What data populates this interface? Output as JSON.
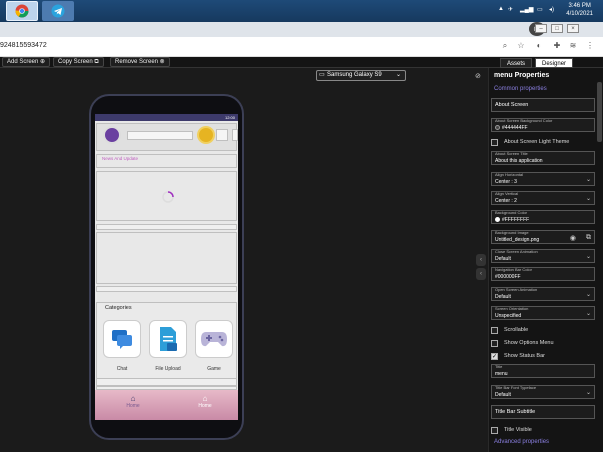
{
  "taskbar": {
    "apps": [
      {
        "name": "Chrome"
      },
      {
        "name": "Telegram"
      }
    ],
    "clock": {
      "time": "3:46 PM",
      "date": "4/10/2021"
    }
  },
  "browser": {
    "url_partial": "924815593472"
  },
  "toolbar": {
    "add_screen": "Add Screen ⊕",
    "copy_screen": "Copy Screen ⧉",
    "remove_screen": "Remove Screen ⊗"
  },
  "device_select": {
    "value": "Samsung Galaxy S9"
  },
  "app_preview": {
    "status_time": "12:00",
    "news_label": "News And Update",
    "categories_title": "Categories",
    "categories": [
      {
        "label": "Chat",
        "icon": "chat-icon"
      },
      {
        "label": "File Upload",
        "icon": "file-upload-icon"
      },
      {
        "label": "Game",
        "icon": "gamepad-icon"
      }
    ],
    "nav": [
      {
        "label": "Home"
      },
      {
        "label": "Home"
      }
    ]
  },
  "panel": {
    "tabs": [
      "Assets",
      "Designer"
    ],
    "active_tab": "Designer",
    "title": "menu Properties",
    "common_link": "Common properties",
    "advanced_link": "Advanced properties",
    "props": [
      {
        "label": "",
        "value": "About Screen"
      },
      {
        "label": "About Screen Background Color",
        "value": "#444444FF"
      },
      {
        "check": false,
        "value": "About Screen Light Theme"
      },
      {
        "label": "About Screen Title",
        "value": "About this application"
      },
      {
        "label": "Align Horizontal",
        "value": "Center : 3"
      },
      {
        "label": "Align Vertical",
        "value": "Center : 2"
      },
      {
        "label": "Background Color",
        "value": "#FFFFFFFF"
      },
      {
        "label": "Background Image",
        "value": "Untitled_design.png"
      },
      {
        "label": "Close Screen Animation",
        "value": "Default"
      },
      {
        "label": "Navigation Bar Color",
        "value": "#000000FF"
      },
      {
        "label": "Open Screen Animation",
        "value": "Default"
      },
      {
        "label": "Screen Orientation",
        "value": "Unspecified"
      },
      {
        "check": false,
        "value": "Scrollable"
      },
      {
        "check": false,
        "value": "Show Options Menu"
      },
      {
        "check": true,
        "value": "Show Status Bar"
      },
      {
        "label": "Title",
        "value": "menu"
      },
      {
        "label": "Title Bar Font Typeface",
        "value": "Default"
      },
      {
        "label": "",
        "value": "Title Bar Subtitle"
      },
      {
        "check": false,
        "value": "Title Visible"
      }
    ]
  },
  "colors": {
    "accent": "#8a7fe0",
    "app_header": "#3d3a6b",
    "nav_bg": "#d8a5b8"
  }
}
